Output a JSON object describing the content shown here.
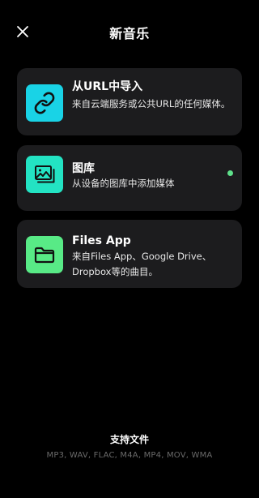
{
  "header": {
    "title": "新音乐",
    "close_icon": "close-icon"
  },
  "colors": {
    "background": "#000000",
    "card": "#1c1c1e",
    "url_icon_bg": "#19d3e6",
    "gallery_icon_bg": "#23e3c3",
    "files_icon_bg": "#58ea86",
    "status_dot": "#5ee08a",
    "muted_text": "#6a6a6a"
  },
  "options": [
    {
      "icon": "link-icon",
      "title": "从URL中导入",
      "description": "来自云端服务或公共URL的任何媒体。"
    },
    {
      "icon": "image-gallery-icon",
      "title": "图库",
      "description": "从设备的图库中添加媒体",
      "status_dot": true
    },
    {
      "icon": "folder-icon",
      "title": "Files App",
      "description": "来自Files App、Google Drive、Dropbox等的曲目。"
    }
  ],
  "footer": {
    "title": "支持文件",
    "formats": "MP3, WAV, FLAC, M4A, MP4, MOV, WMA"
  }
}
